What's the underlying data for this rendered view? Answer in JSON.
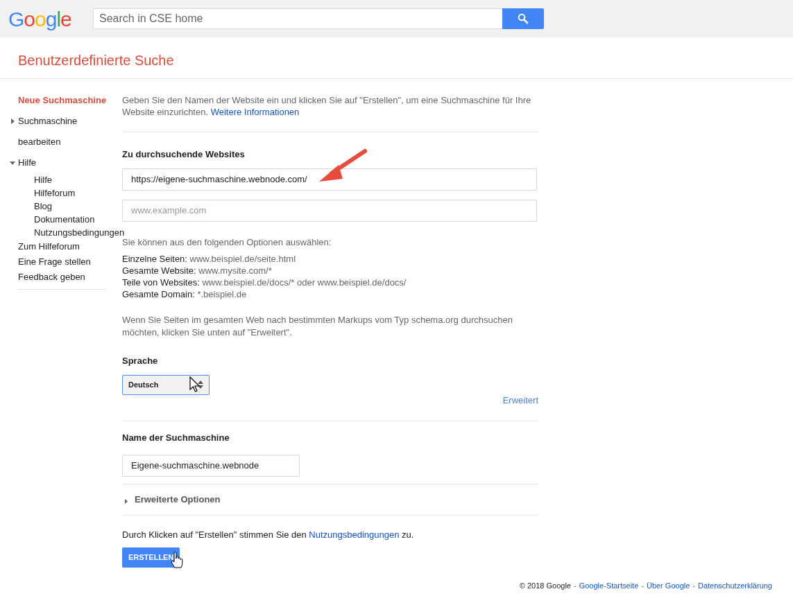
{
  "header": {
    "logo": "Google",
    "search": {
      "placeholder": "Search in CSE home"
    }
  },
  "page_title": "Benutzerdefinierte Suche",
  "sidebar": {
    "items": [
      {
        "label": "Neue Suchmaschine",
        "selected": true
      },
      {
        "label": "Suchmaschine",
        "selected": false,
        "expanded": false
      },
      {
        "label": "bearbeiten",
        "selected": false
      },
      {
        "label": "Hilfe",
        "selected": false,
        "expanded": true,
        "children": [
          {
            "label": "Hilfe"
          },
          {
            "label": "Hilfeforum"
          },
          {
            "label": "Blog"
          },
          {
            "label": "Dokumentation"
          },
          {
            "label": "Nutzungsbedingungen"
          }
        ]
      },
      {
        "label": "Zum Hilfeforum",
        "selected": false
      },
      {
        "label": "Eine Frage stellen",
        "selected": false
      },
      {
        "label": "Feedback geben",
        "selected": false
      }
    ]
  },
  "intro": {
    "text": "Geben Sie den Namen der Website ein und klicken Sie auf \"Erstellen\", um eine Suchmaschine für Ihre Website einzurichten.",
    "link": "Weitere Informationen"
  },
  "sites": {
    "heading": "Zu durchsuchende Websites",
    "fields": [
      {
        "value": "https://eigene-suchmaschine.webnode.com/"
      },
      {
        "placeholder": "www.example.com"
      }
    ]
  },
  "options": {
    "intro": "Sie können aus den folgenden Optionen auswählen:",
    "lines": [
      {
        "label": "Einzelne Seiten:",
        "value": "www.beispiel.de/seite.html"
      },
      {
        "label": "Gesamte Website:",
        "value": "www.mysite.com/*"
      },
      {
        "label": "Teile von Websites:",
        "value": "www.beispiel.de/docs/* oder www.beispiel.de/docs/"
      },
      {
        "label": "Gesamte Domain:",
        "value": "*.beispiel.de"
      }
    ],
    "schema_note": "Wenn Sie Seiten im gesamten Web nach bestimmten Markups vom Typ schema.org durchsuchen möchten, klicken Sie unten auf \"Erweitert\"."
  },
  "language": {
    "heading": "Sprache",
    "value": "Deutsch",
    "advanced_link": "Erweitert"
  },
  "name": {
    "heading": "Name der Suchmaschine",
    "value": "Eigene-suchmaschine.webnode"
  },
  "advanced_options": {
    "label": "Erweiterte Optionen",
    "expanded": false
  },
  "terms": {
    "before": "Durch Klicken auf \"Erstellen\" stimmen Sie den",
    "link": "Nutzungsbedingungen",
    "after": "zu."
  },
  "create_button": "ERSTELLEN",
  "footer": {
    "items": [
      {
        "kind": "text",
        "text": "© 2018 Google"
      },
      {
        "kind": "separator",
        "text": "-"
      },
      {
        "kind": "link",
        "text": "Google-Startseite"
      },
      {
        "kind": "separator",
        "text": "-"
      },
      {
        "kind": "link",
        "text": "Über Google"
      },
      {
        "kind": "separator",
        "text": "-"
      },
      {
        "kind": "link",
        "text": "Datenschutzerklärung"
      }
    ]
  }
}
